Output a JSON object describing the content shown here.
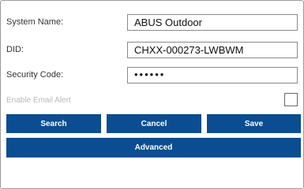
{
  "form": {
    "system_name": {
      "label": "System Name:",
      "value": "ABUS Outdoor"
    },
    "did": {
      "label": "DID:",
      "value": "CHXX-000273-LWBWM"
    },
    "security_code": {
      "label": "Security Code:",
      "value": "••••••"
    },
    "email_alert": {
      "label": "Enable Email Alert",
      "checked": false
    }
  },
  "buttons": {
    "search": "Search",
    "cancel": "Cancel",
    "save": "Save",
    "advanced": "Advanced"
  },
  "colors": {
    "button_bg": "#0b4d91",
    "button_text": "#ffffff"
  }
}
